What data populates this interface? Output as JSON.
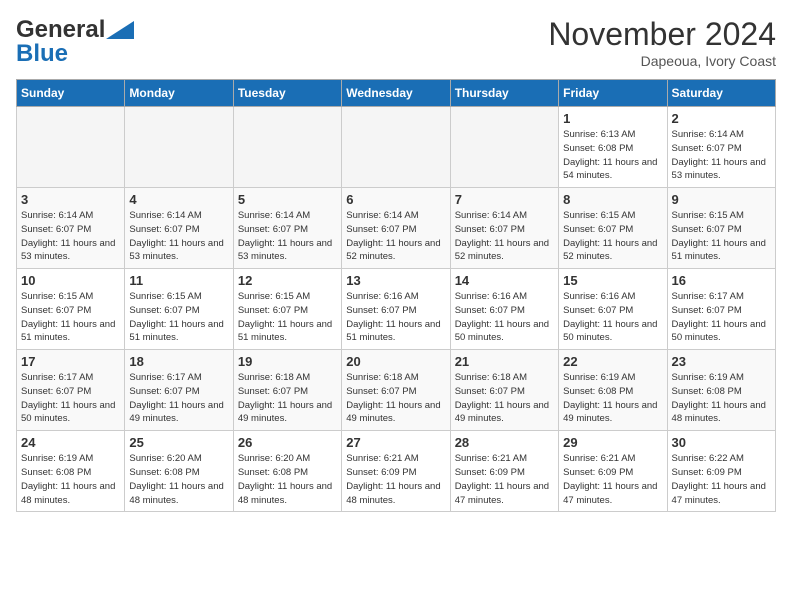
{
  "header": {
    "logo_line1": "General",
    "logo_line2": "Blue",
    "month_title": "November 2024",
    "location": "Dapeoua, Ivory Coast"
  },
  "days_of_week": [
    "Sunday",
    "Monday",
    "Tuesday",
    "Wednesday",
    "Thursday",
    "Friday",
    "Saturday"
  ],
  "weeks": [
    [
      {
        "day": "",
        "empty": true
      },
      {
        "day": "",
        "empty": true
      },
      {
        "day": "",
        "empty": true
      },
      {
        "day": "",
        "empty": true
      },
      {
        "day": "",
        "empty": true
      },
      {
        "day": "1",
        "sunrise": "6:13 AM",
        "sunset": "6:08 PM",
        "daylight": "11 hours and 54 minutes."
      },
      {
        "day": "2",
        "sunrise": "6:14 AM",
        "sunset": "6:07 PM",
        "daylight": "11 hours and 53 minutes."
      }
    ],
    [
      {
        "day": "3",
        "sunrise": "6:14 AM",
        "sunset": "6:07 PM",
        "daylight": "11 hours and 53 minutes."
      },
      {
        "day": "4",
        "sunrise": "6:14 AM",
        "sunset": "6:07 PM",
        "daylight": "11 hours and 53 minutes."
      },
      {
        "day": "5",
        "sunrise": "6:14 AM",
        "sunset": "6:07 PM",
        "daylight": "11 hours and 53 minutes."
      },
      {
        "day": "6",
        "sunrise": "6:14 AM",
        "sunset": "6:07 PM",
        "daylight": "11 hours and 52 minutes."
      },
      {
        "day": "7",
        "sunrise": "6:14 AM",
        "sunset": "6:07 PM",
        "daylight": "11 hours and 52 minutes."
      },
      {
        "day": "8",
        "sunrise": "6:15 AM",
        "sunset": "6:07 PM",
        "daylight": "11 hours and 52 minutes."
      },
      {
        "day": "9",
        "sunrise": "6:15 AM",
        "sunset": "6:07 PM",
        "daylight": "11 hours and 51 minutes."
      }
    ],
    [
      {
        "day": "10",
        "sunrise": "6:15 AM",
        "sunset": "6:07 PM",
        "daylight": "11 hours and 51 minutes."
      },
      {
        "day": "11",
        "sunrise": "6:15 AM",
        "sunset": "6:07 PM",
        "daylight": "11 hours and 51 minutes."
      },
      {
        "day": "12",
        "sunrise": "6:15 AM",
        "sunset": "6:07 PM",
        "daylight": "11 hours and 51 minutes."
      },
      {
        "day": "13",
        "sunrise": "6:16 AM",
        "sunset": "6:07 PM",
        "daylight": "11 hours and 51 minutes."
      },
      {
        "day": "14",
        "sunrise": "6:16 AM",
        "sunset": "6:07 PM",
        "daylight": "11 hours and 50 minutes."
      },
      {
        "day": "15",
        "sunrise": "6:16 AM",
        "sunset": "6:07 PM",
        "daylight": "11 hours and 50 minutes."
      },
      {
        "day": "16",
        "sunrise": "6:17 AM",
        "sunset": "6:07 PM",
        "daylight": "11 hours and 50 minutes."
      }
    ],
    [
      {
        "day": "17",
        "sunrise": "6:17 AM",
        "sunset": "6:07 PM",
        "daylight": "11 hours and 50 minutes."
      },
      {
        "day": "18",
        "sunrise": "6:17 AM",
        "sunset": "6:07 PM",
        "daylight": "11 hours and 49 minutes."
      },
      {
        "day": "19",
        "sunrise": "6:18 AM",
        "sunset": "6:07 PM",
        "daylight": "11 hours and 49 minutes."
      },
      {
        "day": "20",
        "sunrise": "6:18 AM",
        "sunset": "6:07 PM",
        "daylight": "11 hours and 49 minutes."
      },
      {
        "day": "21",
        "sunrise": "6:18 AM",
        "sunset": "6:07 PM",
        "daylight": "11 hours and 49 minutes."
      },
      {
        "day": "22",
        "sunrise": "6:19 AM",
        "sunset": "6:08 PM",
        "daylight": "11 hours and 49 minutes."
      },
      {
        "day": "23",
        "sunrise": "6:19 AM",
        "sunset": "6:08 PM",
        "daylight": "11 hours and 48 minutes."
      }
    ],
    [
      {
        "day": "24",
        "sunrise": "6:19 AM",
        "sunset": "6:08 PM",
        "daylight": "11 hours and 48 minutes."
      },
      {
        "day": "25",
        "sunrise": "6:20 AM",
        "sunset": "6:08 PM",
        "daylight": "11 hours and 48 minutes."
      },
      {
        "day": "26",
        "sunrise": "6:20 AM",
        "sunset": "6:08 PM",
        "daylight": "11 hours and 48 minutes."
      },
      {
        "day": "27",
        "sunrise": "6:21 AM",
        "sunset": "6:09 PM",
        "daylight": "11 hours and 48 minutes."
      },
      {
        "day": "28",
        "sunrise": "6:21 AM",
        "sunset": "6:09 PM",
        "daylight": "11 hours and 47 minutes."
      },
      {
        "day": "29",
        "sunrise": "6:21 AM",
        "sunset": "6:09 PM",
        "daylight": "11 hours and 47 minutes."
      },
      {
        "day": "30",
        "sunrise": "6:22 AM",
        "sunset": "6:09 PM",
        "daylight": "11 hours and 47 minutes."
      }
    ]
  ]
}
